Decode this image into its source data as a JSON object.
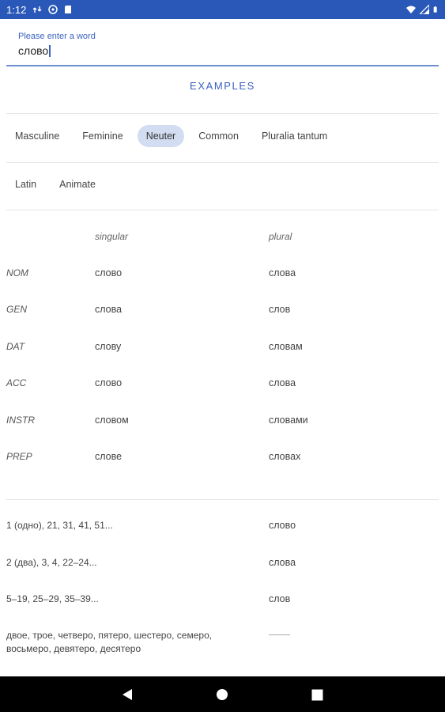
{
  "status_bar": {
    "time": "1:12"
  },
  "search": {
    "label": "Please enter a word",
    "value": "слово"
  },
  "examples_label": "EXAMPLES",
  "gender_chips": [
    {
      "label": "Masculine",
      "selected": false
    },
    {
      "label": "Feminine",
      "selected": false
    },
    {
      "label": "Neuter",
      "selected": true
    },
    {
      "label": "Common",
      "selected": false
    },
    {
      "label": "Pluralia tantum",
      "selected": false
    }
  ],
  "other_chips": [
    {
      "label": "Latin",
      "selected": false
    },
    {
      "label": "Animate",
      "selected": false
    }
  ],
  "declension": {
    "headers": {
      "singular": "singular",
      "plural": "plural"
    },
    "rows": [
      {
        "case": "NOM",
        "singular": "слово",
        "plural": "слова"
      },
      {
        "case": "GEN",
        "singular": "слова",
        "plural": "слов"
      },
      {
        "case": "DAT",
        "singular": "слову",
        "plural": "словам"
      },
      {
        "case": "ACC",
        "singular": "слово",
        "plural": "слова"
      },
      {
        "case": "INSTR",
        "singular": "словом",
        "plural": "словами"
      },
      {
        "case": "PREP",
        "singular": "слове",
        "plural": "словах"
      }
    ]
  },
  "numerals": [
    {
      "numbers": "1 (одно), 21, 31, 41, 51...",
      "form": "слово"
    },
    {
      "numbers": "2 (два), 3, 4, 22–24...",
      "form": "слова"
    },
    {
      "numbers": "5–19, 25–29, 35–39...",
      "form": "слов"
    },
    {
      "numbers": "двое, трое, четверо, пятеро, шестеро, семеро, восьмеро, девятеро, десятеро",
      "form": ""
    }
  ],
  "colors": {
    "status_bar": "#2a58b8",
    "accent": "#3b62bf",
    "selected_chip": "#d3ddf1",
    "nav_bar": "#000000"
  },
  "icons": {
    "status_left": [
      "signal-icon",
      "sync-icon",
      "sd-card-icon"
    ],
    "status_right": [
      "wifi-icon",
      "cellular-icon",
      "battery-icon"
    ],
    "nav": [
      "back-icon",
      "home-icon",
      "recents-icon"
    ]
  }
}
